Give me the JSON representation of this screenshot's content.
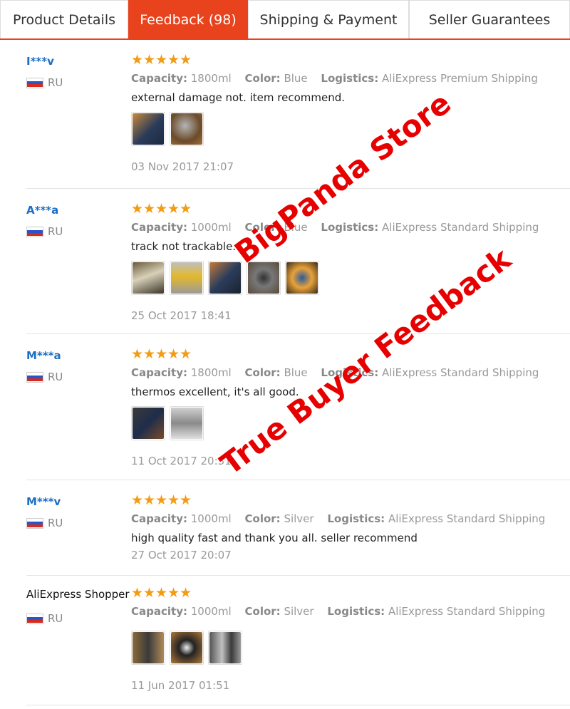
{
  "tabs": [
    {
      "label": "Product Details",
      "active": false
    },
    {
      "label": "Feedback (98)",
      "active": true
    },
    {
      "label": "Shipping & Payment",
      "active": false
    },
    {
      "label": "Seller Guarantees",
      "active": false
    }
  ],
  "labels": {
    "capacity": "Capacity:",
    "color": "Color:",
    "logistics": "Logistics:"
  },
  "colors": {
    "accent": "#e8431c",
    "star": "#f39c12",
    "username": "#1a6ec4",
    "watermark": "#e60000"
  },
  "reviews": [
    {
      "user": "I***v",
      "country": "RU",
      "rating": 5,
      "capacity": "1800ml",
      "color": "Blue",
      "logistics": "AliExpress Premium Shipping",
      "comment": "external damage not. item recommend.",
      "photo_count": 2,
      "date": "03 Nov 2017 21:07"
    },
    {
      "user": "A***a",
      "country": "RU",
      "rating": 5,
      "capacity": "1000ml",
      "color": "Blue",
      "logistics": "AliExpress Standard Shipping",
      "comment": "track not trackable.",
      "photo_count": 5,
      "date": "25 Oct 2017 18:41"
    },
    {
      "user": "M***a",
      "country": "RU",
      "rating": 5,
      "capacity": "1800ml",
      "color": "Blue",
      "logistics": "AliExpress Standard Shipping",
      "comment": "thermos excellent, it's all good.",
      "photo_count": 2,
      "date": "11 Oct 2017 20:31"
    },
    {
      "user": "M***v",
      "country": "RU",
      "rating": 5,
      "capacity": "1000ml",
      "color": "Silver",
      "logistics": "AliExpress Standard Shipping",
      "comment": "high quality fast and thank you all. seller recommend",
      "photo_count": 0,
      "date": "27 Oct 2017 20:07"
    },
    {
      "user": "AliExpress Shopper",
      "country": "RU",
      "rating": 5,
      "capacity": "1000ml",
      "color": "Silver",
      "logistics": "AliExpress Standard Shipping",
      "comment": "",
      "photo_count": 3,
      "date": "11 Jun 2017 01:51"
    }
  ],
  "watermarks": [
    "BigPanda Store",
    "True Buyer Feedback"
  ]
}
